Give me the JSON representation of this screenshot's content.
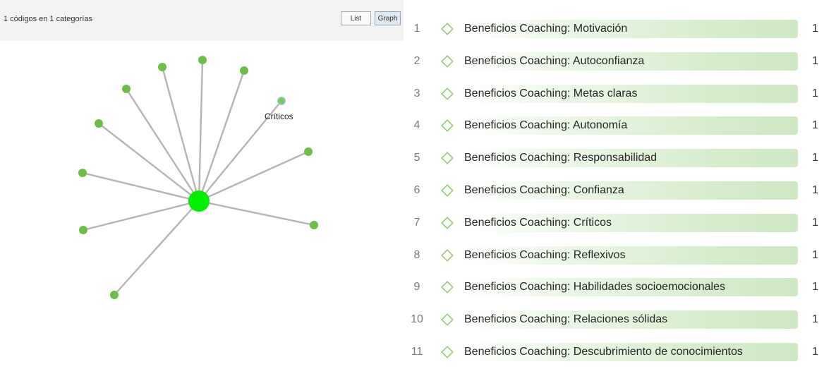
{
  "header": {
    "summary": "1 códigos en 1 categorías",
    "list_button": "List",
    "graph_button": "Graph"
  },
  "graph": {
    "highlighted_label": "Críticos",
    "colors": {
      "hub": "#00ee00",
      "leaf": "#6cbf44",
      "edge": "#b5b5b5"
    }
  },
  "codes": [
    {
      "index": "1",
      "label": "Beneficios Coaching: Motivación",
      "count": "1"
    },
    {
      "index": "2",
      "label": "Beneficios Coaching: Autoconfianza",
      "count": "1"
    },
    {
      "index": "3",
      "label": "Beneficios Coaching: Metas claras",
      "count": "1"
    },
    {
      "index": "4",
      "label": "Beneficios Coaching: Autonomía",
      "count": "1"
    },
    {
      "index": "5",
      "label": "Beneficios Coaching: Responsabilidad",
      "count": "1"
    },
    {
      "index": "6",
      "label": "Beneficios Coaching: Confianza",
      "count": "1"
    },
    {
      "index": "7",
      "label": "Beneficios Coaching: Críticos",
      "count": "1"
    },
    {
      "index": "8",
      "label": "Beneficios Coaching: Reflexivos",
      "count": "1"
    },
    {
      "index": "9",
      "label": "Beneficios Coaching: Habilidades socioemocionales",
      "count": "1"
    },
    {
      "index": "10",
      "label": "Beneficios Coaching: Relaciones sólidas",
      "count": "1"
    },
    {
      "index": "11",
      "label": "Beneficios Coaching: Descubrimiento de conocimientos",
      "count": "1"
    }
  ],
  "icons": {
    "code_icon": "diamond-icon"
  }
}
